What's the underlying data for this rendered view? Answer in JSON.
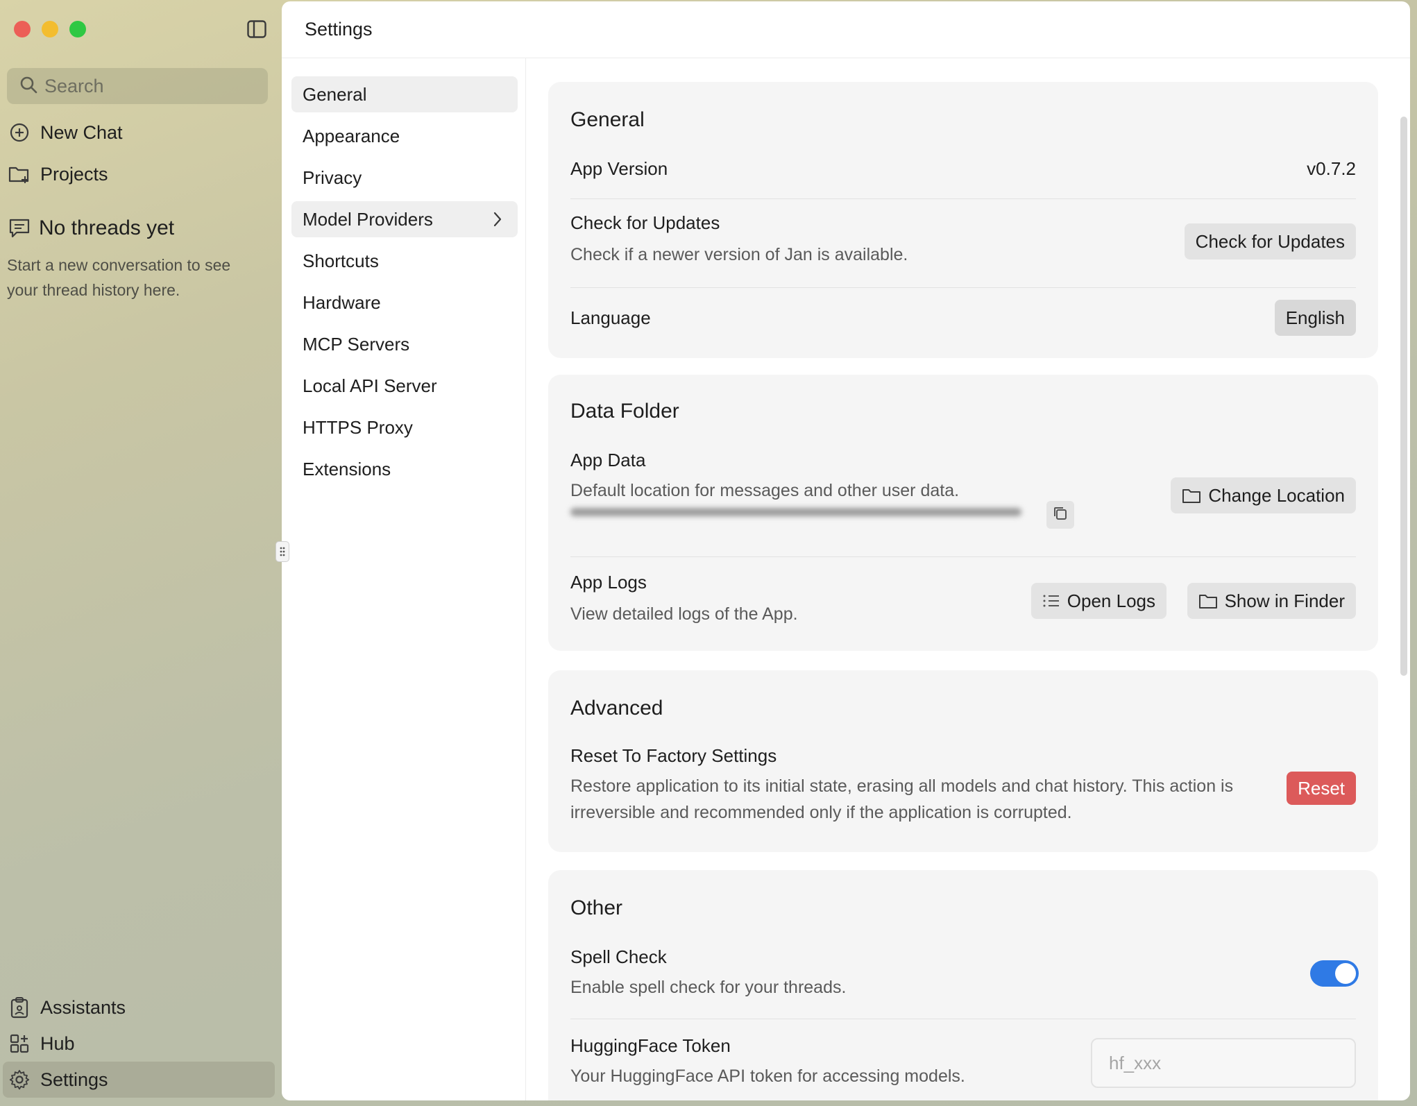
{
  "sidebar": {
    "search_placeholder": "Search",
    "new_chat": "New Chat",
    "projects": "Projects",
    "empty_title": "No threads yet",
    "empty_desc": "Start a new conversation to see your thread history here.",
    "bottom": {
      "assistants": "Assistants",
      "hub": "Hub",
      "settings": "Settings"
    }
  },
  "header": {
    "title": "Settings"
  },
  "settings_nav": {
    "items": [
      {
        "label": "General",
        "active": true
      },
      {
        "label": "Appearance"
      },
      {
        "label": "Privacy"
      },
      {
        "label": "Model Providers",
        "has_chevron": true
      },
      {
        "label": "Shortcuts"
      },
      {
        "label": "Hardware"
      },
      {
        "label": "MCP Servers"
      },
      {
        "label": "Local API Server"
      },
      {
        "label": "HTTPS Proxy"
      },
      {
        "label": "Extensions"
      }
    ]
  },
  "general": {
    "title": "General",
    "app_version_label": "App Version",
    "app_version_value": "v0.7.2",
    "updates_title": "Check for Updates",
    "updates_desc": "Check if a newer version of Jan is available.",
    "updates_button": "Check for Updates",
    "language_label": "Language",
    "language_value": "English"
  },
  "data_folder": {
    "title": "Data Folder",
    "app_data_title": "App Data",
    "app_data_desc": "Default location for messages and other user data.",
    "change_location_button": "Change Location",
    "app_logs_title": "App Logs",
    "app_logs_desc": "View detailed logs of the App.",
    "open_logs_button": "Open Logs",
    "show_in_finder_button": "Show in Finder"
  },
  "advanced": {
    "title": "Advanced",
    "reset_title": "Reset To Factory Settings",
    "reset_desc": "Restore application to its initial state, erasing all models and chat history. This action is irreversible and recommended only if the application is corrupted.",
    "reset_button": "Reset"
  },
  "other": {
    "title": "Other",
    "spell_check_title": "Spell Check",
    "spell_check_desc": "Enable spell check for your threads.",
    "spell_check_enabled": true,
    "hf_token_title": "HuggingFace Token",
    "hf_token_desc": "Your HuggingFace API token for accessing models.",
    "hf_token_placeholder": "hf_xxx",
    "hf_token_value": ""
  },
  "colors": {
    "accent": "#2f7ae5",
    "danger": "#dc5a5a",
    "card_bg": "#f5f5f5"
  }
}
